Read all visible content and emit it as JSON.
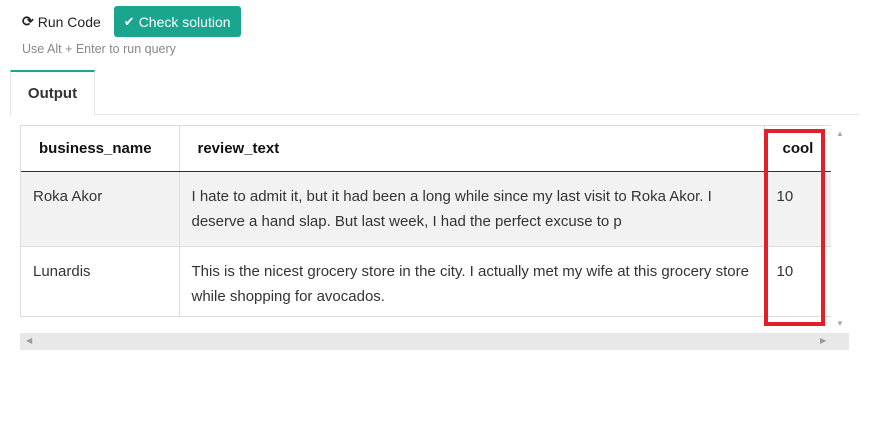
{
  "toolbar": {
    "run_label": "Run Code",
    "check_label": "Check solution",
    "hint": "Use Alt + Enter to run query"
  },
  "tabs": [
    {
      "label": "Output"
    }
  ],
  "table": {
    "columns": [
      "business_name",
      "review_text",
      "cool"
    ],
    "rows": [
      [
        "Roka Akor",
        "I hate to admit it, but it had been a long while since my last visit to Roka Akor. I deserve a hand slap. But last week, I had the perfect excuse to p",
        "10"
      ],
      [
        "Lunardis",
        "This is the nicest grocery store in the city. I actually met my wife at this grocery store while shopping for avocados.",
        "10"
      ]
    ]
  },
  "icons": {
    "run": "refresh-icon",
    "check": "checkmark-icon"
  },
  "colors": {
    "accent": "#1aa58f",
    "highlight": "#e0202a"
  }
}
